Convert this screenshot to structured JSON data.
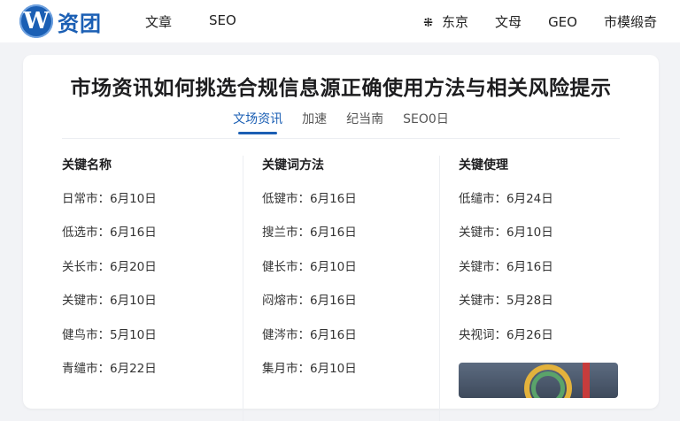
{
  "header": {
    "logo_mark": "W",
    "logo_text": "资团",
    "nav_left": [
      "文章",
      "SEO"
    ],
    "location_icon": "location-icon",
    "nav_right": [
      "东京",
      "文母",
      "GEO",
      "市模缎奇"
    ],
    "brand_color": "#1b5fb4"
  },
  "article": {
    "title": "市场资讯如何挑选合规信息源正确使用方法与相关风险提示",
    "tabs": [
      "文场资讯",
      "加速",
      "纪当南",
      "SEO0日"
    ],
    "active_tab_index": 0
  },
  "columns": [
    {
      "header": "关键名称",
      "rows": [
        "日常市：6月10日",
        "低选市：6月16日",
        "关长市：6月20日",
        "关键市：6月10日",
        "健鸟市：5月10日",
        "青缱市：6月22日"
      ]
    },
    {
      "header": "关键词方法",
      "rows": [
        "低键市：6月16日",
        "搜兰市：6月16日",
        "健长市：6月10日",
        "闷熔市：6月16日",
        "健涔市：6月16日",
        "集月市：6月10日"
      ]
    },
    {
      "header": "关键使理",
      "rows": [
        "低缱市：6月24日",
        "关键市：6月10日",
        "关键市：6月16日",
        "关键市：5月28日",
        "央视词：6月26日"
      ]
    }
  ]
}
